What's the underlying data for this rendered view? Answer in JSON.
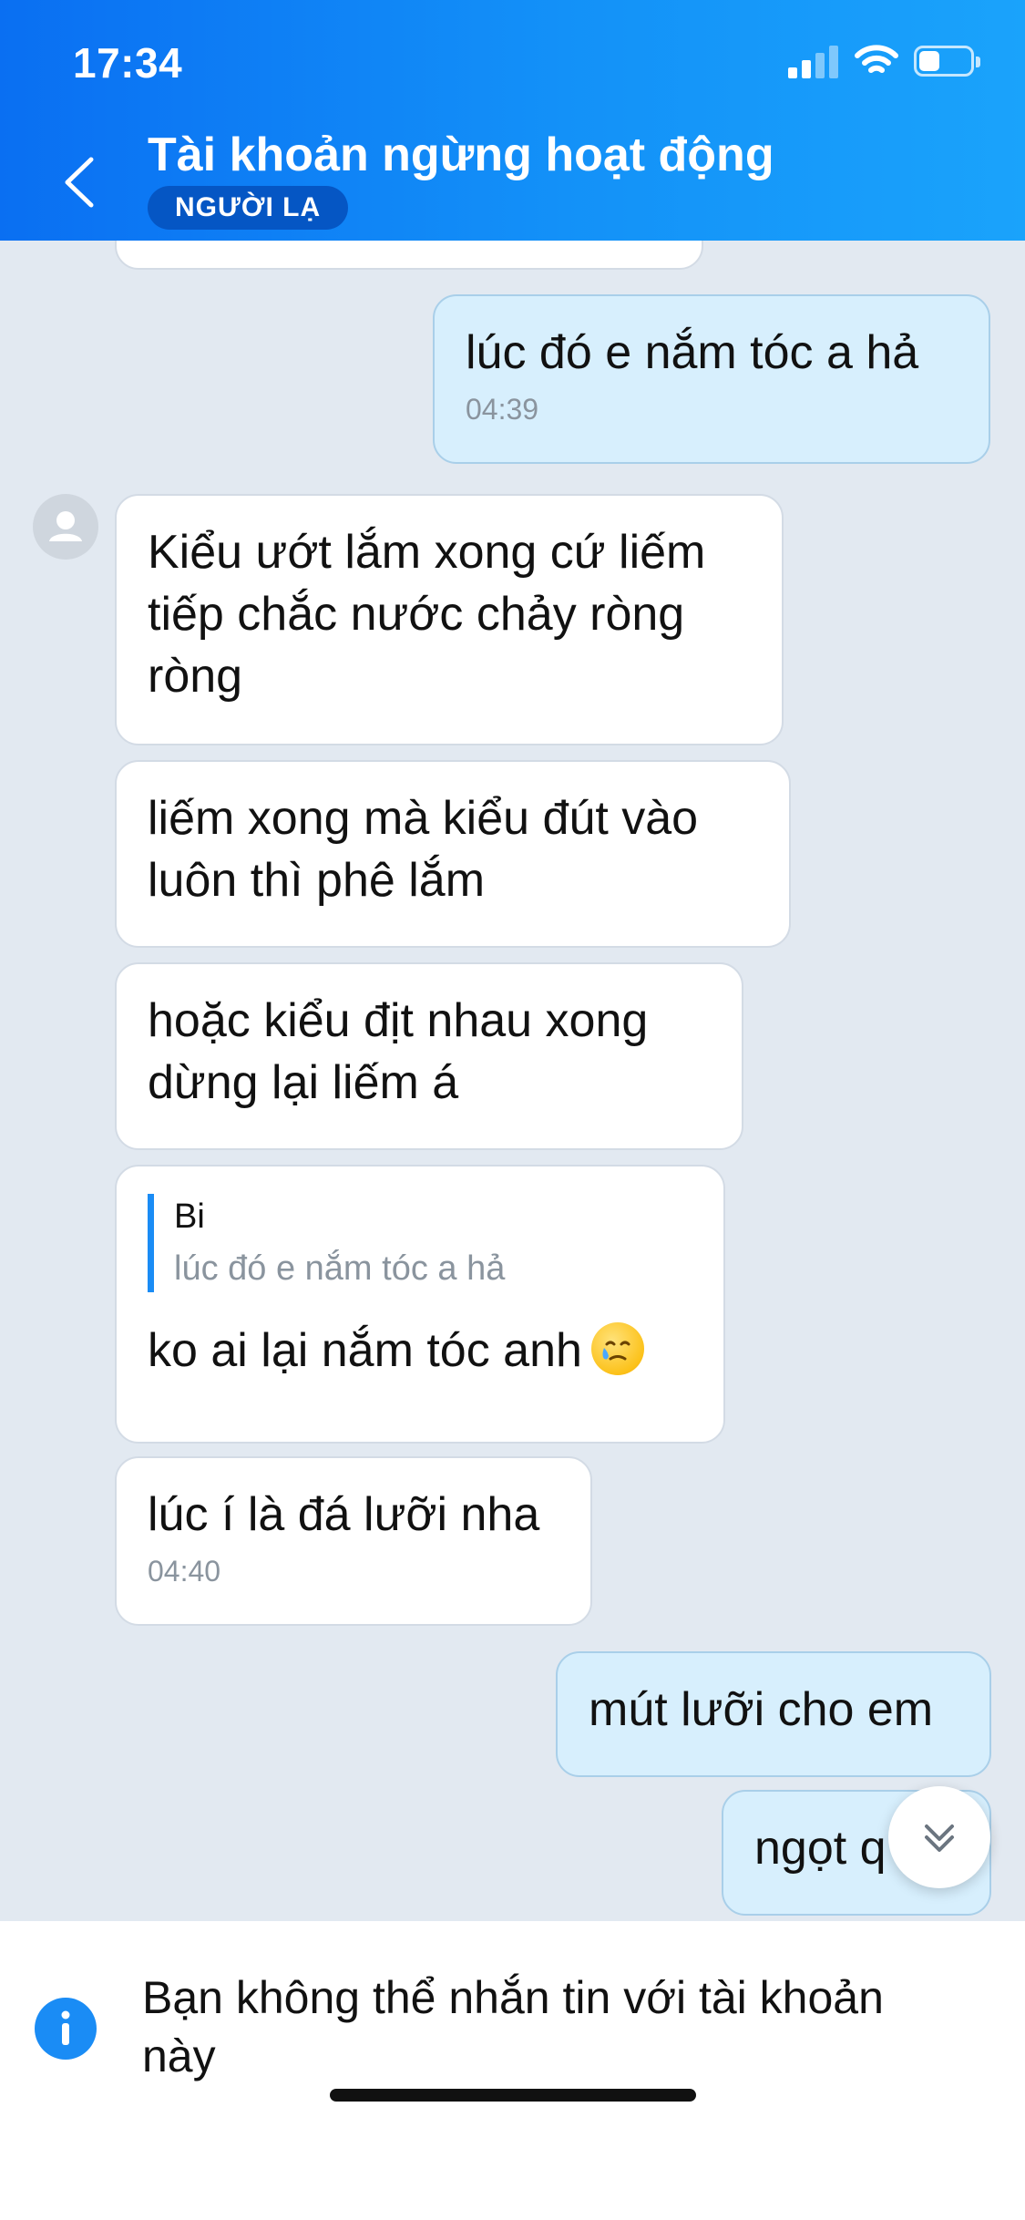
{
  "status_bar": {
    "time": "17:34"
  },
  "header": {
    "title": "Tài khoản ngừng hoạt động",
    "badge": "NGƯỜI LẠ"
  },
  "messages": [
    {
      "id": "partial",
      "direction": "received",
      "text": ""
    },
    {
      "id": "m1",
      "direction": "sent",
      "text": "lúc đó e nắm tóc a hả",
      "time": "04:39"
    },
    {
      "id": "m2",
      "direction": "received",
      "text": "Kiểu ướt lắm xong cứ liếm tiếp chắc nước chảy ròng ròng"
    },
    {
      "id": "m3",
      "direction": "received",
      "text": "liếm xong mà kiểu đút vào luôn thì phê lắm"
    },
    {
      "id": "m4",
      "direction": "received",
      "text": "hoặc kiểu địt nhau xong dừng lại liếm á"
    },
    {
      "id": "m5",
      "direction": "received",
      "quote": {
        "sender": "Bi",
        "text": "lúc đó e nắm tóc a hả"
      },
      "text": "ko ai lại nắm tóc anh",
      "emoji": "face-holding-back-tears"
    },
    {
      "id": "m6",
      "direction": "received",
      "text": "lúc í là đá lưỡi nha",
      "time": "04:40"
    },
    {
      "id": "m7",
      "direction": "sent",
      "text": "mút lưỡi cho em"
    },
    {
      "id": "m8",
      "direction": "sent",
      "text": "ngọt q"
    }
  ],
  "footer": {
    "notice": "Bạn không thể nhắn tin với tài khoản này",
    "icon": "info-icon"
  },
  "colors": {
    "header_start": "#0a6ff2",
    "header_end": "#1aa3fb",
    "chat_background": "#e2e9f1",
    "sent_bubble": "#d7effd",
    "received_bubble": "#ffffff",
    "badge_background": "#0556c4",
    "quote_bar": "#1a8cf5",
    "info_icon": "#1a8cf5"
  }
}
